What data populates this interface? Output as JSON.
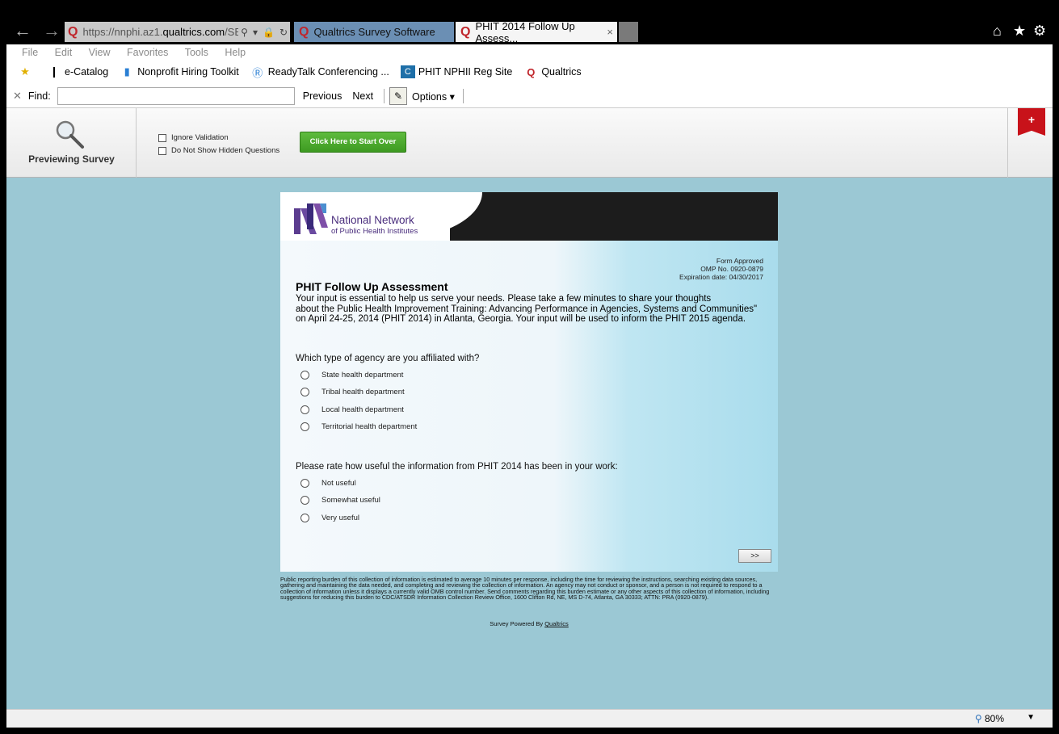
{
  "browser": {
    "address_scheme": "https://",
    "address_sub": "nnphi.az1.",
    "address_domain": "qualtrics.com",
    "address_path": "/SE",
    "tabs": [
      {
        "label": "Qualtrics Survey Software"
      },
      {
        "label": "PHIT 2014 Follow Up Assess..."
      }
    ],
    "tab_close": "×"
  },
  "menu": {
    "items": [
      {
        "label": "File"
      },
      {
        "label": "Edit"
      },
      {
        "label": "View"
      },
      {
        "label": "Favorites"
      },
      {
        "label": "Tools"
      },
      {
        "label": "Help"
      }
    ]
  },
  "favorites": {
    "items": [
      {
        "label": "e-Catalog"
      },
      {
        "label": "Nonprofit Hiring Toolkit"
      },
      {
        "label": "ReadyTalk Conferencing ..."
      },
      {
        "label": "PHIT NPHII Reg Site"
      },
      {
        "label": "Qualtrics"
      }
    ]
  },
  "find": {
    "label": "Find:",
    "value": "",
    "previous": "Previous",
    "next": "Next",
    "options": "Options"
  },
  "preview": {
    "label": "Previewing Survey",
    "ignore_validation": "Ignore Validation",
    "hide_hidden": "Do Not Show Hidden Questions",
    "start_over": "Click Here to Start Over"
  },
  "survey": {
    "logo_line1": "National Network",
    "logo_line2": "of Public Health Institutes",
    "form_approved": "Form Approved",
    "omp_no": "OMP No. 0920-0879",
    "expiration": "Expiration date: 04/30/2017",
    "title": "PHIT Follow Up Assessment",
    "intro_line1": "Your input is essential to help us serve your needs.  Please take a few minutes to share your thoughts",
    "intro_line2": "about the Public Health Improvement Training: Advancing Performance in Agencies, Systems and Communities\"",
    "intro_line3": "on April 24-25, 2014 (PHIT 2014) in Atlanta, Georgia.  Your input will be used to inform the PHIT 2015 agenda.",
    "q1": {
      "text": "Which type of agency are you affiliated with?",
      "choices": [
        {
          "label": "State health department"
        },
        {
          "label": "Tribal health department"
        },
        {
          "label": "Local health department"
        },
        {
          "label": "Territorial health department"
        }
      ]
    },
    "q2": {
      "text": "Please rate how useful the information from PHIT 2014 has been in your work:",
      "choices": [
        {
          "label": "Not useful"
        },
        {
          "label": "Somewhat useful"
        },
        {
          "label": "Very useful"
        }
      ]
    },
    "next_button": ">>",
    "footer_note": "Public reporting burden of this collection of information is estimated to average 10 minutes per response, including the time for reviewing the instructions, searching existing data sources, gathering and maintaining the data needed, and completing and reviewing the collection of information. An agency may not conduct or sponsor, and a person is not required to respond to a collection of information unless it displays a currently valid OMB control number. Send comments regarding this burden estimate or any other aspects of this collection of information, including suggestions for reducing this burden to CDC/ATSDR Information Collection Review Office, 1600 Clifton Rd, NE, MS D-74, Atlanta, GA 30333; ATTN: PRA (0920-0879).",
    "powered_prefix": "Survey Powered By",
    "powered_link": "Qualtrics"
  },
  "status": {
    "zoom": "80%"
  },
  "colors": {
    "viewport_bg": "#9bc8d4",
    "start_button": "#4aa92c",
    "brand_purple": "#4a2e7d",
    "qualtrics_red": "#c0262c"
  }
}
